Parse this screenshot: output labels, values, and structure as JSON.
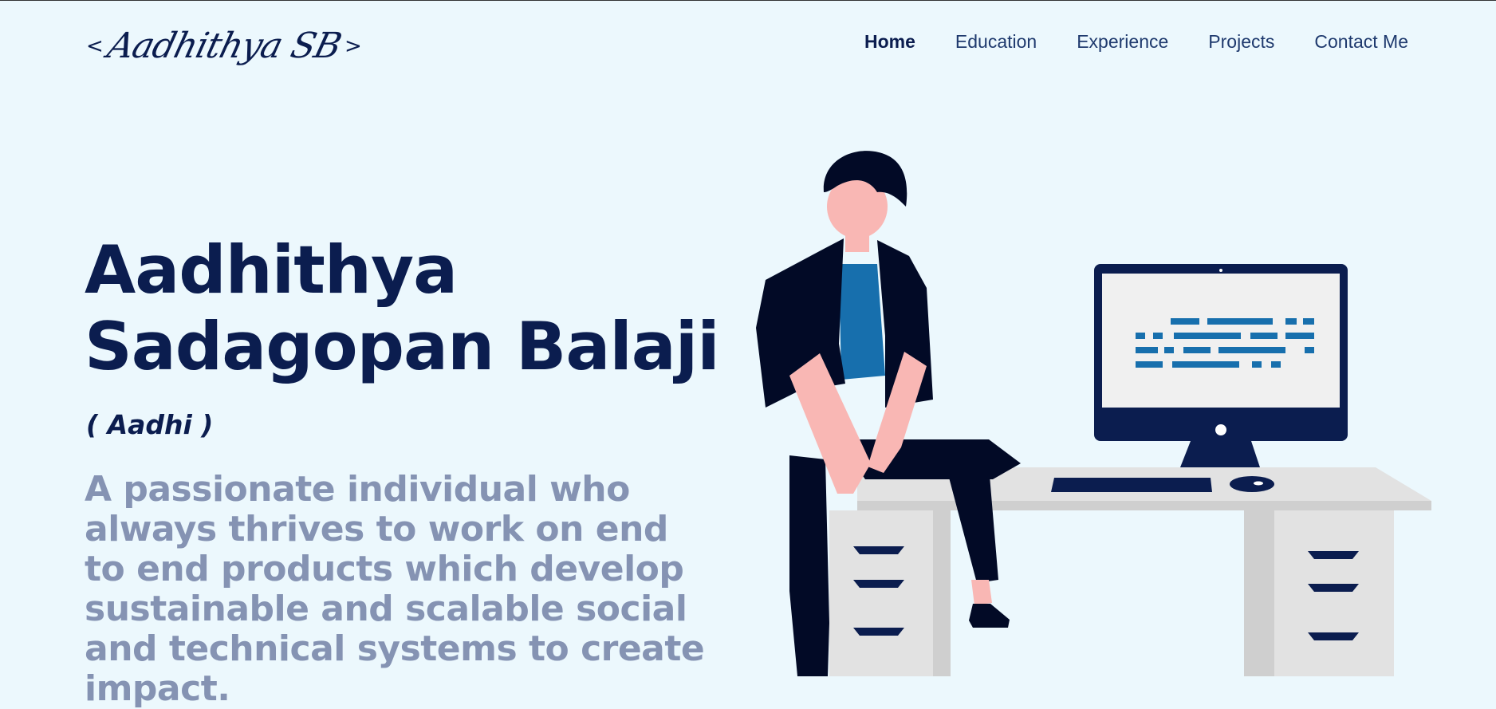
{
  "logo": {
    "open_bracket": "<",
    "signature": "Aadhithya SB",
    "close_bracket": ">"
  },
  "nav": {
    "items": [
      {
        "label": "Home",
        "active": true
      },
      {
        "label": "Education",
        "active": false
      },
      {
        "label": "Experience",
        "active": false
      },
      {
        "label": "Projects",
        "active": false
      },
      {
        "label": "Contact Me",
        "active": false
      }
    ]
  },
  "hero": {
    "name_line1": "Aadhithya",
    "name_line2": "Sadagopan Balaji",
    "nickname": "( Aadhi )",
    "tagline": "A passionate individual who always thrives to work on end to end products which develop sustainable and scalable social and technical systems to create impact."
  },
  "colors": {
    "background": "#ecf8fd",
    "primary": "#0b1d4f",
    "tagline": "#8593b3",
    "accent_blue": "#176fad",
    "skin": "#f9b7b4",
    "desk": "#e2e2e2"
  },
  "icons": {
    "illustration": "person-sitting-at-desk-illustration"
  }
}
